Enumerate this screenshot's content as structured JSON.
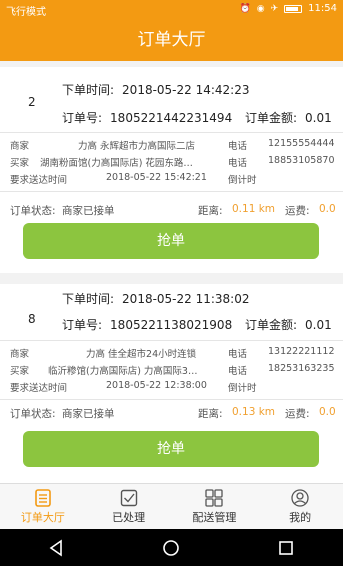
{
  "status": {
    "left": "飞行模式",
    "right_time": "11:54"
  },
  "header": {
    "title": "订单大厅"
  },
  "orders": [
    {
      "index": "2",
      "order_time_label": "下单时间:",
      "order_time": "2018-05-22 14:42:23",
      "order_no_label": "订单号:",
      "order_no": "1805221442231494",
      "amount_label": "订单金额:",
      "amount": "0.01",
      "merchant_label": "商家",
      "merchant": "力高 永辉超市力高国际二店",
      "merchant_phone_label": "电话",
      "merchant_phone": "12155554444",
      "buyer_label": "买家",
      "buyer": "湖南粉面馆(力高国际店) 花园东路…",
      "buyer_phone_label": "电话",
      "buyer_phone": "18853105870",
      "deliver_label": "要求送达时间",
      "deliver_time": "2018-05-22 15:42:21",
      "countdown_label": "倒计时",
      "status_label": "订单状态:",
      "status": "商家已接单",
      "distance_label": "距离:",
      "distance": "0.11 km",
      "fee_label": "运费:",
      "fee": "0.0",
      "button": "抢单"
    },
    {
      "index": "8",
      "order_time_label": "下单时间:",
      "order_time": "2018-05-22 11:38:02",
      "order_no_label": "订单号:",
      "order_no": "1805221138021908",
      "amount_label": "订单金额:",
      "amount": "0.01",
      "merchant_label": "商家",
      "merchant": "力高 佳全超市24小时连锁",
      "merchant_phone_label": "电话",
      "merchant_phone": "13122221112",
      "buyer_label": "买家",
      "buyer": "临沂糁馆(力高国际店) 力高国际3…",
      "buyer_phone_label": "电话",
      "buyer_phone": "18253163235",
      "deliver_label": "要求送达时间",
      "deliver_time": "2018-05-22 12:38:00",
      "countdown_label": "倒计时",
      "status_label": "订单状态:",
      "status": "商家已接单",
      "distance_label": "距离:",
      "distance": "0.13 km",
      "fee_label": "运费:",
      "fee": "0.0",
      "button": "抢单"
    }
  ],
  "tabs": [
    {
      "label": "订单大厅",
      "icon": "list-icon"
    },
    {
      "label": "已处理",
      "icon": "check-box-icon"
    },
    {
      "label": "配送管理",
      "icon": "grid-icon"
    },
    {
      "label": "我的",
      "icon": "user-icon"
    }
  ],
  "colors": {
    "accent": "#f39a12",
    "button": "#8cc53f",
    "highlight": "#f0a030"
  }
}
